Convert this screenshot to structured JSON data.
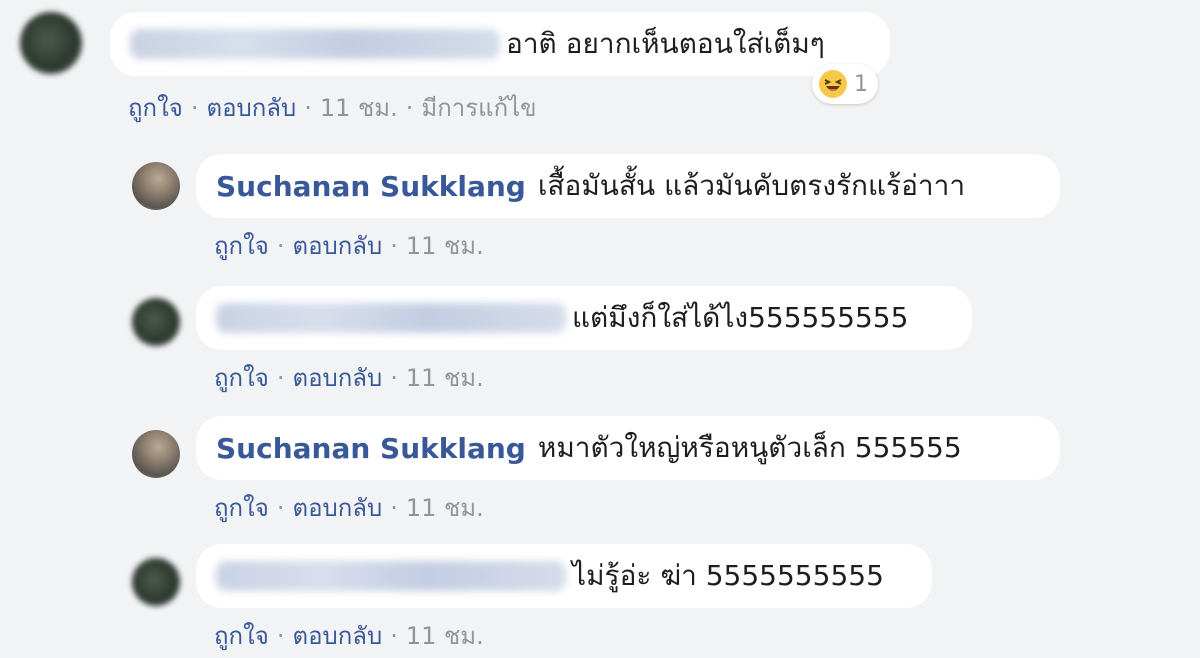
{
  "comments": [
    {
      "author": "Kanyapak Yoosboktin",
      "author_blurred": true,
      "text": "อาติ อยากเห็นตอนใส่เต็มๆ",
      "like": "ถูกใจ",
      "reply": "ตอบกลับ",
      "time": "11 ชม.",
      "edited": "มีการแก้ไข",
      "reaction": {
        "icon": "haha-emoji-icon",
        "count": "1"
      }
    },
    {
      "author": "Suchanan Sukklang",
      "author_blurred": false,
      "text": "เสื้อมันสั้น แล้วมันคับตรงรักแร้อ่าาา",
      "like": "ถูกใจ",
      "reply": "ตอบกลับ",
      "time": "11 ชม."
    },
    {
      "author": "Kanyapak Yoosboktin",
      "author_blurred": true,
      "text": "แต่มึงก็ใส่ได้ไง555555555",
      "like": "ถูกใจ",
      "reply": "ตอบกลับ",
      "time": "11 ชม."
    },
    {
      "author": "Suchanan Sukklang",
      "author_blurred": false,
      "text": "หมาตัวใหญ่หรือหนูตัวเล็ก 555555",
      "like": "ถูกใจ",
      "reply": "ตอบกลับ",
      "time": "11 ชม."
    },
    {
      "author": "Kanyapak Yoosboktin",
      "author_blurred": true,
      "text": "ไม่รู้อ่ะ ฆ่า 5555555555",
      "like": "ถูกใจ",
      "reply": "ตอบกลับ",
      "time": "11 ชม."
    }
  ],
  "colors": {
    "background": "#f2f3f5",
    "bubble": "#ffffff",
    "author_link": "#385898",
    "meta": "#90949c",
    "text": "#1c1e21"
  }
}
